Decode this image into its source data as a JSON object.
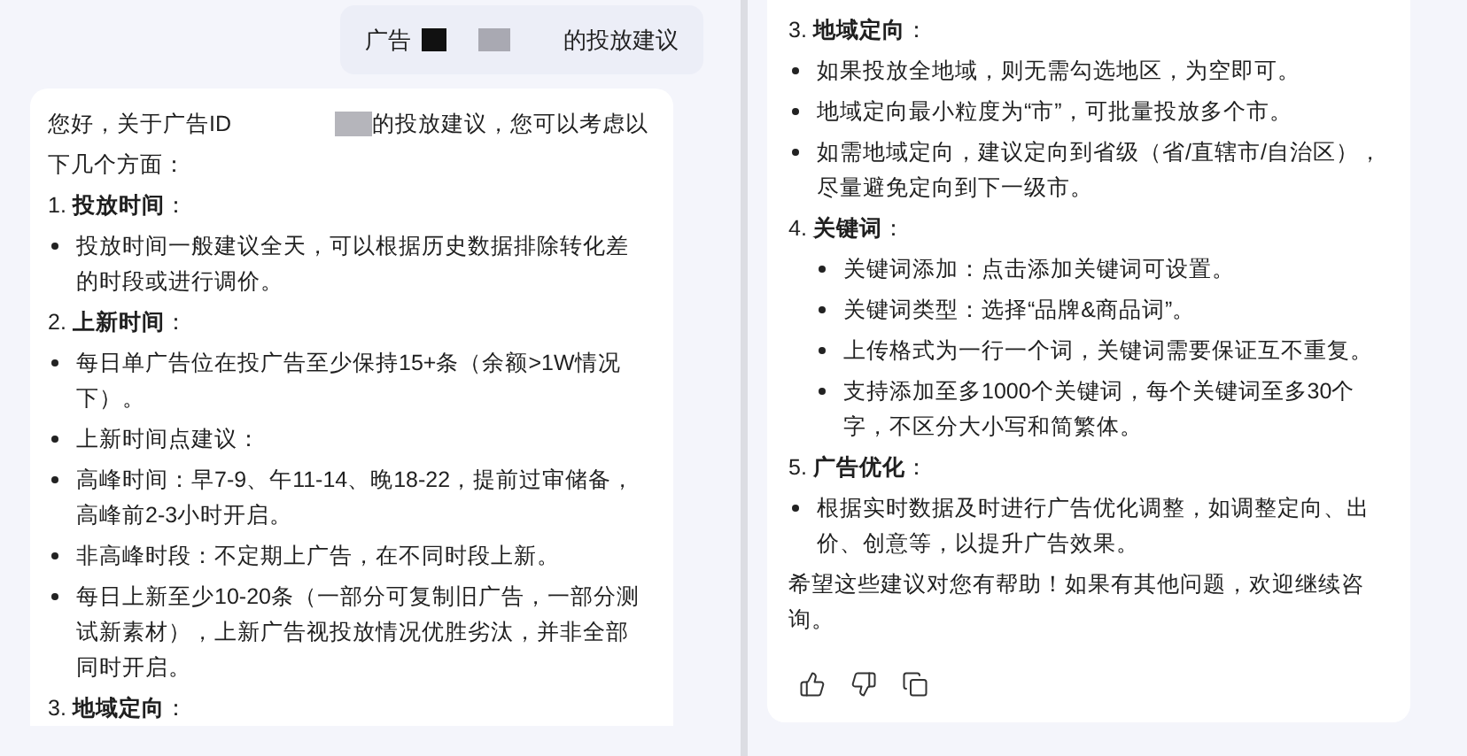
{
  "left_pane": {
    "user_message": {
      "prefix": "广告",
      "suffix": "的投放建议"
    },
    "answer": {
      "intro_prefix": "您好，关于广告ID",
      "intro_suffix": "的投放建议，您可以考虑以",
      "intro_line2": "下几个方面：",
      "sections": [
        {
          "heading": "1. **投放时间**：",
          "indented": false,
          "bullets": [
            "投放时间一般建议全天，可以根据历史数据排除转化差的时段或进行调价。"
          ]
        },
        {
          "heading": "2. **上新时间**：",
          "indented": false,
          "bullets": [
            "每日单广告位在投广告至少保持15+条（余额>1W情况下）。",
            "上新时间点建议：",
            "高峰时间：早7-9、午11-14、晚18-22，提前过审储备，高峰前2-3小时开启。",
            "非高峰时段：不定期上广告，在不同时段上新。",
            "每日上新至少10-20条（一部分可复制旧广告，一部分测试新素材），上新广告视投放情况优胜劣汰，并非全部同时开启。"
          ]
        },
        {
          "heading": "3. **地域定向**："
        }
      ]
    }
  },
  "right_pane": {
    "answer": {
      "sections": [
        {
          "heading": "3. **地域定向**：",
          "indented": false,
          "bullets": [
            "如果投放全地域，则无需勾选地区，为空即可。",
            "地域定向最小粒度为“市”，可批量投放多个市。",
            "如需地域定向，建议定向到省级（省/直辖市/自治区），尽量避免定向到下一级市。"
          ]
        },
        {
          "heading": "4. **关键词**：",
          "indented": true,
          "bullets": [
            "关键词添加：点击添加关键词可设置。",
            "关键词类型：选择“品牌&商品词”。",
            "上传格式为一行一个词，关键词需要保证互不重复。",
            "支持添加至多1000个关键词，每个关键词至多30个字，不区分大小写和简繁体。"
          ]
        },
        {
          "heading": "5. **广告优化**：",
          "indented": false,
          "bullets": [
            "根据实时数据及时进行广告优化调整，如调整定向、出价、创意等，以提升广告效果。"
          ]
        }
      ],
      "closing": "希望这些建议对您有帮助！如果有其他问题，欢迎继续咨询。"
    }
  }
}
